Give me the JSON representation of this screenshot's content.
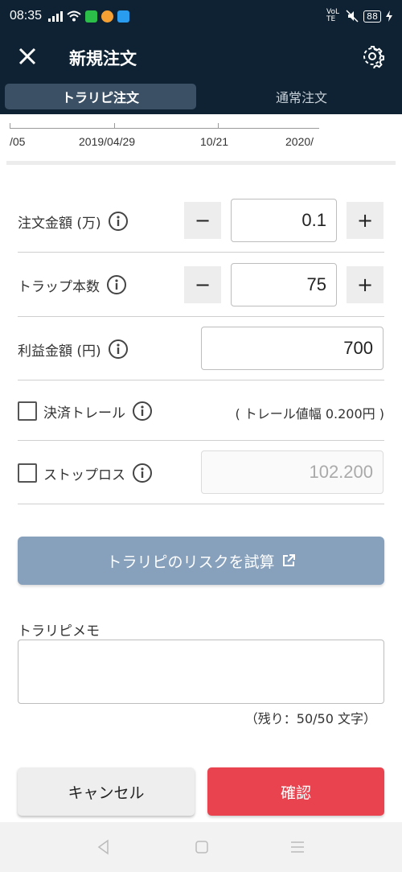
{
  "status_bar": {
    "time": "08:35",
    "network": "VoLTE",
    "battery": "88",
    "icons": [
      "signal-icon",
      "wifi-icon",
      "line-app-icon",
      "weather-app-icon",
      "twitter-app-icon",
      "mute-icon",
      "battery-icon",
      "charging-icon"
    ]
  },
  "header": {
    "title": "新規注文",
    "close_icon": "close-icon",
    "settings_icon": "gear-icon"
  },
  "tabs": [
    {
      "label": "トラリピ注文",
      "active": true
    },
    {
      "label": "通常注文",
      "active": false
    }
  ],
  "axis": {
    "labels": [
      "/05",
      "2019/04/29",
      "10/21",
      "2020/"
    ]
  },
  "form": {
    "order_amount": {
      "label": "注文金額 (万)",
      "value": "0.1",
      "minus": "−",
      "plus": "+"
    },
    "trap_count": {
      "label": "トラップ本数",
      "value": "75",
      "minus": "−",
      "plus": "+"
    },
    "profit_amount": {
      "label": "利益金額 (円)",
      "value": "700"
    },
    "trailing": {
      "label": "決済トレール",
      "checked": false,
      "note": "( トレール値幅 0.200円 )"
    },
    "stop_loss": {
      "label": "ストップロス",
      "checked": false,
      "value": "102.200"
    }
  },
  "risk_button": {
    "label": "トラリピのリスクを試算",
    "icon": "external-link-icon"
  },
  "memo": {
    "label": "トラリピメモ",
    "value": "",
    "counter": "（残り：50/50 文字）"
  },
  "actions": {
    "cancel": "キャンセル",
    "confirm": "確認"
  },
  "colors": {
    "header_bg": "#0e2233",
    "active_tab": "#3b5065",
    "risk_button": "#87a0bc",
    "confirm_button": "#e8434f"
  }
}
